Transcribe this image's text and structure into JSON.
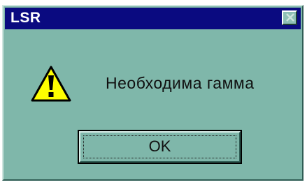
{
  "window": {
    "title": "LSR"
  },
  "dialog": {
    "icon": "warning-icon",
    "message": "Необходима гамма",
    "ok_label": "OK"
  },
  "colors": {
    "titlebar": "#0a0a80",
    "window_background": "#7fb7aa",
    "warning_yellow": "#ffff00"
  }
}
